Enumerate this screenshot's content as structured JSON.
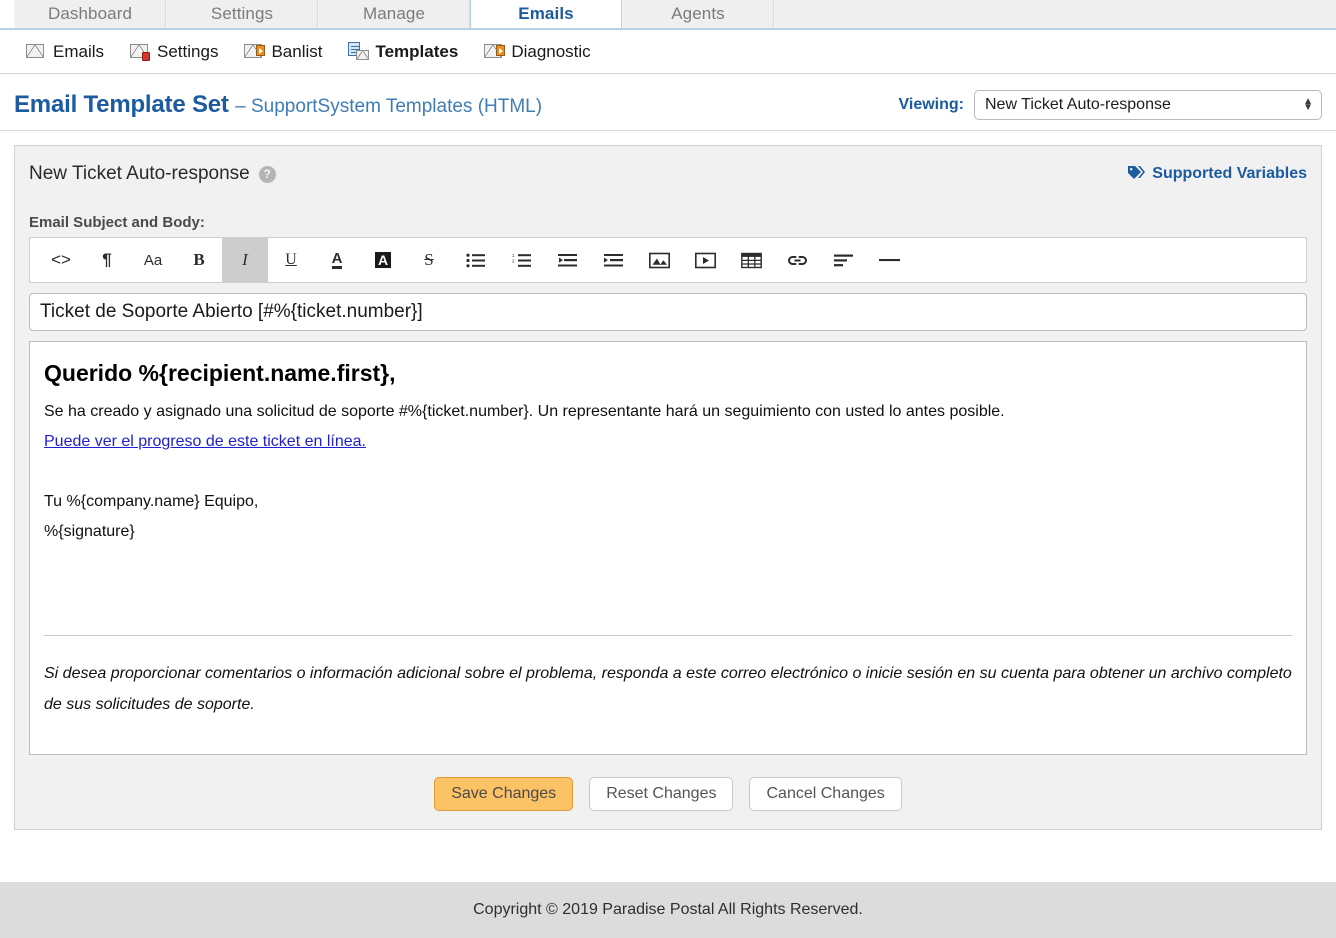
{
  "colors": {
    "accent_blue": "#1c5ba0",
    "tab_active_border": "#b7d0e8",
    "save_button_bg": "#fbc266",
    "save_button_border": "#e09b34",
    "footer_bg": "#dcdcdc",
    "link_blue": "#2020d0"
  },
  "tabs": [
    {
      "label": "Dashboard",
      "active": false
    },
    {
      "label": "Settings",
      "active": false
    },
    {
      "label": "Manage",
      "active": false
    },
    {
      "label": "Emails",
      "active": true
    },
    {
      "label": "Agents",
      "active": false
    }
  ],
  "subnav": [
    {
      "label": "Emails",
      "icon": "envelope-icon",
      "active": false
    },
    {
      "label": "Settings",
      "icon": "envelope-wrench-icon",
      "active": false
    },
    {
      "label": "Banlist",
      "icon": "envelope-arrow-icon",
      "active": false
    },
    {
      "label": "Templates",
      "icon": "envelope-document-icon",
      "active": true
    },
    {
      "label": "Diagnostic",
      "icon": "envelope-arrow-icon",
      "active": false
    }
  ],
  "header": {
    "title": "Email Template Set",
    "subtitle": "– SupportSystem Templates (HTML)",
    "viewing_label": "Viewing:",
    "viewing_value": "New Ticket Auto-response"
  },
  "panel": {
    "title": "New Ticket Auto-response",
    "help_glyph": "?",
    "supported_variables_label": "Supported Variables"
  },
  "editor": {
    "section_label": "Email Subject and Body:",
    "toolbar": [
      {
        "name": "source-code-icon",
        "glyph": "<>",
        "active": false
      },
      {
        "name": "paragraph-format-icon",
        "glyph": "¶",
        "active": false
      },
      {
        "name": "font-size-icon",
        "glyph": "Aa",
        "active": false
      },
      {
        "name": "bold-icon",
        "glyph": "B",
        "active": false
      },
      {
        "name": "italic-icon",
        "glyph": "I",
        "active": true
      },
      {
        "name": "underline-icon",
        "glyph": "U",
        "active": false
      },
      {
        "name": "text-color-icon",
        "glyph": "A",
        "active": false
      },
      {
        "name": "background-color-icon",
        "glyph": "A",
        "active": false
      },
      {
        "name": "strikethrough-icon",
        "glyph": "S",
        "active": false
      },
      {
        "name": "bullet-list-icon",
        "glyph": "",
        "active": false
      },
      {
        "name": "numbered-list-icon",
        "glyph": "",
        "active": false
      },
      {
        "name": "outdent-icon",
        "glyph": "",
        "active": false
      },
      {
        "name": "indent-icon",
        "glyph": "",
        "active": false
      },
      {
        "name": "insert-image-icon",
        "glyph": "",
        "active": false
      },
      {
        "name": "insert-video-icon",
        "glyph": "",
        "active": false
      },
      {
        "name": "insert-table-icon",
        "glyph": "",
        "active": false
      },
      {
        "name": "insert-link-icon",
        "glyph": "",
        "active": false
      },
      {
        "name": "align-icon",
        "glyph": "",
        "active": false
      },
      {
        "name": "horizontal-rule-icon",
        "glyph": "",
        "active": false
      }
    ],
    "subject_value": "Ticket de Soporte Abierto [#%{ticket.number}]",
    "body": {
      "greeting": "Querido %{recipient.name.first},",
      "paragraph": "Se ha creado y asignado una solicitud de soporte #%{ticket.number}. Un representante hará un seguimiento con usted lo antes posible.",
      "link": "Puede ver el progreso de este ticket en línea.",
      "signoff_line1": "Tu %{company.name} Equipo,",
      "signoff_line2": "%{signature}",
      "note": "Si desea proporcionar comentarios o información adicional sobre el problema, responda a este correo electrónico o inicie sesión en su cuenta para obtener un archivo completo de sus solicitudes de soporte."
    }
  },
  "buttons": {
    "save": "Save Changes",
    "reset": "Reset Changes",
    "cancel": "Cancel Changes"
  },
  "footer": {
    "copyright": "Copyright © 2019 Paradise Postal All Rights Reserved."
  }
}
